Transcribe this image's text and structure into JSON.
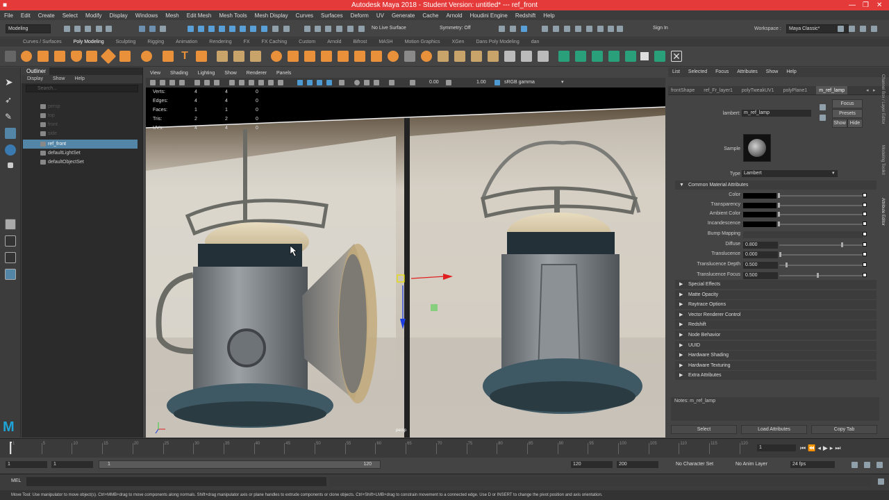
{
  "window": {
    "title": "Autodesk Maya 2018 - Student Version: untitled*   ---   ref_front"
  },
  "menubar": [
    "File",
    "Edit",
    "Create",
    "Select",
    "Modify",
    "Display",
    "Windows",
    "Mesh",
    "Edit Mesh",
    "Mesh Tools",
    "Mesh Display",
    "Curves",
    "Surfaces",
    "Deform",
    "UV",
    "Generate",
    "Cache",
    "Arnold",
    "Houdini Engine",
    "Redshift",
    "Help"
  ],
  "statusline": {
    "mode": "Modeling",
    "live_surface": "No Live Surface",
    "symmetry": "Symmetry: Off",
    "sign_in": "Sign In",
    "workspace_label": "Workspace :",
    "workspace": "Maya Classic*"
  },
  "shelf_tabs": [
    "Curves / Surfaces",
    "Poly Modeling",
    "Sculpting",
    "Rigging",
    "Animation",
    "Rendering",
    "FX",
    "FX Caching",
    "Custom",
    "Arnold",
    "Bifrost",
    "MASH",
    "Motion Graphics",
    "XGen",
    "Dans Poly Modeling",
    "dan"
  ],
  "outliner": {
    "title": "Outliner",
    "menu": [
      "Display",
      "Show",
      "Help"
    ],
    "search_placeholder": "Search...",
    "items": [
      {
        "label": "persp"
      },
      {
        "label": "top"
      },
      {
        "label": "front"
      },
      {
        "label": "side"
      },
      {
        "label": "ref_front"
      },
      {
        "label": "defaultLightSet"
      },
      {
        "label": "defaultObjectSet"
      }
    ]
  },
  "viewport": {
    "menu": [
      "View",
      "Shading",
      "Lighting",
      "Show",
      "Renderer",
      "Panels"
    ],
    "exposure": "0.00",
    "gamma": "1.00",
    "colorspace": "sRGB gamma",
    "hud": [
      [
        "Verts:",
        "4",
        "4",
        "0"
      ],
      [
        "Edges:",
        "4",
        "4",
        "0"
      ],
      [
        "Faces:",
        "1",
        "1",
        "0"
      ],
      [
        "Tris:",
        "2",
        "2",
        "0"
      ],
      [
        "UVs:",
        "4",
        "4",
        "0"
      ]
    ],
    "camera": "persp"
  },
  "attribute_editor": {
    "menu": [
      "List",
      "Selected",
      "Focus",
      "Attributes",
      "Show",
      "Help"
    ],
    "tabs": [
      "frontShape",
      "ref_Fr_layer1",
      "polyTweakUV1",
      "polyPlane1",
      "m_ref_lamp"
    ],
    "lambert_label": "lambert:",
    "lambert_value": "m_ref_lamp",
    "focus": "Focus",
    "presets": "Presets",
    "show": "Show",
    "hide": "Hide",
    "sample_label": "Sample",
    "type_label": "Type",
    "type_value": "Lambert",
    "common_section": "Common Material Attributes",
    "attrs": [
      {
        "label": "Color",
        "value": ""
      },
      {
        "label": "Transparency",
        "value": ""
      },
      {
        "label": "Ambient Color",
        "value": ""
      },
      {
        "label": "Incandescence",
        "value": ""
      },
      {
        "label": "Bump Mapping",
        "value": ""
      },
      {
        "label": "Diffuse",
        "value": "0.800"
      },
      {
        "label": "Translucence",
        "value": "0.000"
      },
      {
        "label": "Translucence Depth",
        "value": "0.500"
      },
      {
        "label": "Translucence Focus",
        "value": "0.500"
      }
    ],
    "sections": [
      "Special Effects",
      "Matte Opacity",
      "Raytrace Options",
      "Vector Renderer Control",
      "Redshift",
      "Node Behavior",
      "UUID",
      "Hardware Shading",
      "Hardware Texturing",
      "Extra Attributes"
    ],
    "notes": "Notes:  m_ref_lamp",
    "buttons": [
      "Select",
      "Load Attributes",
      "Copy Tab"
    ],
    "side_tabs": [
      "Channel Box / Layer Editor",
      "Modeling Toolkit",
      "Attribute Editor"
    ]
  },
  "timeline": {
    "ticks": [
      "1",
      "5",
      "10",
      "15",
      "20",
      "25",
      "30",
      "35",
      "40",
      "45",
      "50",
      "55",
      "60",
      "65",
      "70",
      "75",
      "80",
      "85",
      "90",
      "95",
      "100",
      "105",
      "110",
      "115",
      "120"
    ],
    "current": "1"
  },
  "range": {
    "start": "1",
    "start2": "1",
    "range_start": "1",
    "range_end": "120",
    "end": "120",
    "end2": "200",
    "character_set": "No Character Set",
    "anim_layer": "No Anim Layer",
    "fps": "24 fps"
  },
  "cmdline": {
    "lang": "MEL"
  },
  "helpline": "Move Tool: Use manipulator to move object(s). Ctrl+MMB+drag to move components along normals. Shift+drag manipulator axis or plane handles to extrude components or clone objects. Ctrl+Shift+LMB+drag to constrain movement to a connected edge. Use D or INSERT to change the pivot position and axis orientation."
}
